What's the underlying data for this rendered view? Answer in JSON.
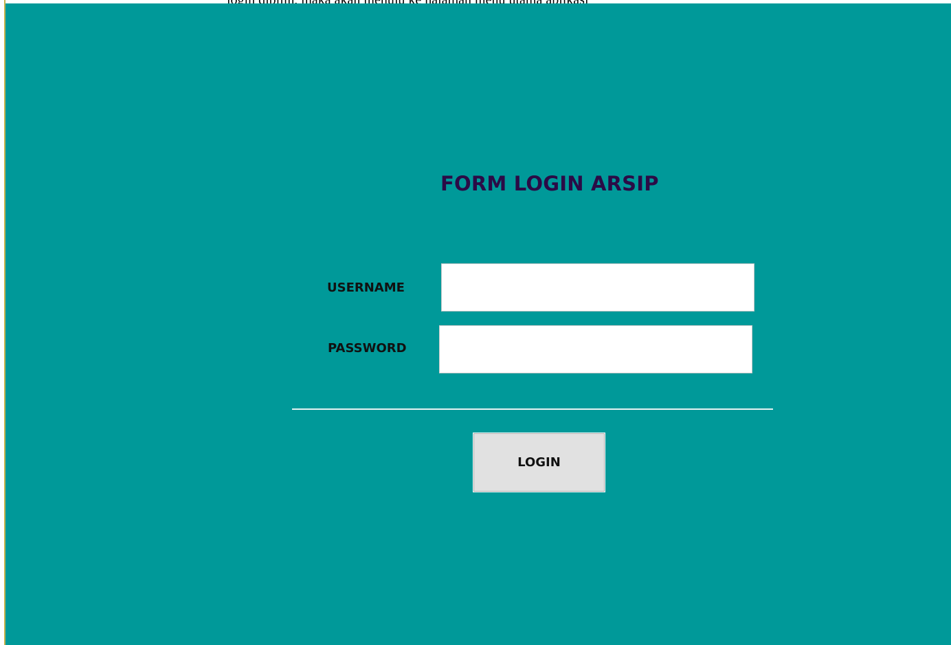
{
  "window": {
    "top_caption": "login dipilih, maka akan menuju ke halaman menu utama aplikasi"
  },
  "form": {
    "title": "FORM LOGIN ARSIP",
    "username_label": "USERNAME",
    "username_value": "",
    "password_label": "PASSWORD",
    "password_value": "",
    "login_button_label": "LOGIN"
  },
  "colors": {
    "background": "#009999",
    "title": "#2b0b46",
    "button": "#e1e1e1",
    "edge": "#c8b24a"
  }
}
